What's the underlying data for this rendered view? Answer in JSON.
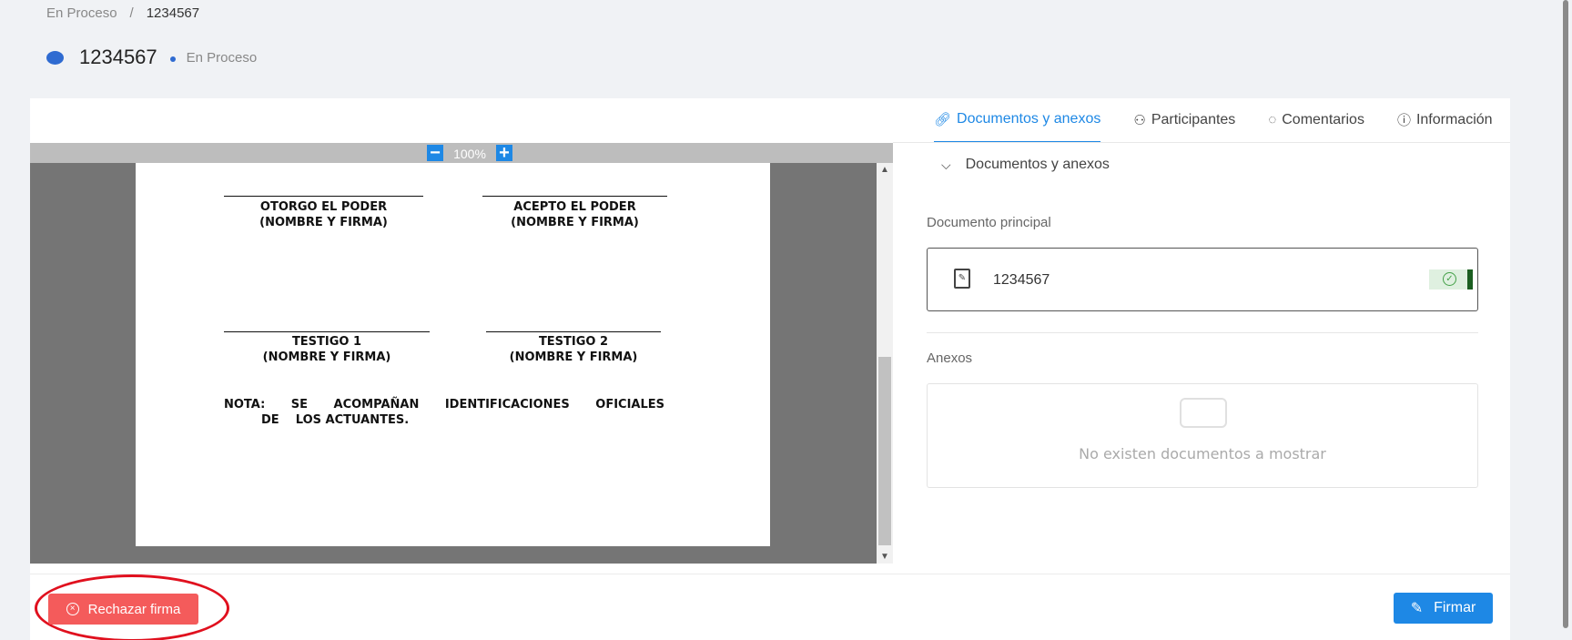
{
  "breadcrumb": {
    "parent": "En Proceso",
    "separator": "/",
    "current": "1234567"
  },
  "header": {
    "title": "1234567",
    "status": "En Proceso"
  },
  "viewer": {
    "zoom_out": "−",
    "zoom_level": "100%",
    "zoom_in": "+",
    "signatures": {
      "grantor_line1": "OTORGO EL PODER",
      "grantor_line2": "(NOMBRE Y FIRMA)",
      "acceptor_line1": "ACEPTO EL PODER",
      "acceptor_line2": "(NOMBRE Y FIRMA)",
      "witness1_line1": "TESTIGO 1",
      "witness1_line2": "(NOMBRE Y FIRMA)",
      "witness2_line1": "TESTIGO 2",
      "witness2_line2": "(NOMBRE Y FIRMA)"
    },
    "note": {
      "words_row1": [
        "NOTA:",
        "SE",
        "ACOMPAÑAN",
        "IDENTIFICACIONES",
        "OFICIALES"
      ],
      "row2": "DE    LOS ACTUANTES."
    }
  },
  "tabs": [
    {
      "label": "Documentos y anexos",
      "icon": "paperclip-icon"
    },
    {
      "label": "Participantes",
      "icon": "people-icon"
    },
    {
      "label": "Comentarios",
      "icon": "comments-icon"
    },
    {
      "label": "Información",
      "icon": "info-icon"
    }
  ],
  "documents": {
    "section_title": "Documentos y anexos",
    "main_label": "Documento principal",
    "main_doc_name": "1234567",
    "annex_label": "Anexos",
    "empty_text": "No existen documentos a mostrar"
  },
  "actions": {
    "reject_label": "Rechazar firma",
    "sign_label": "Firmar"
  },
  "colors": {
    "accent": "#1e88e5",
    "reject": "#f45b5b",
    "highlight": "#e0101e",
    "success": "#43a047"
  }
}
